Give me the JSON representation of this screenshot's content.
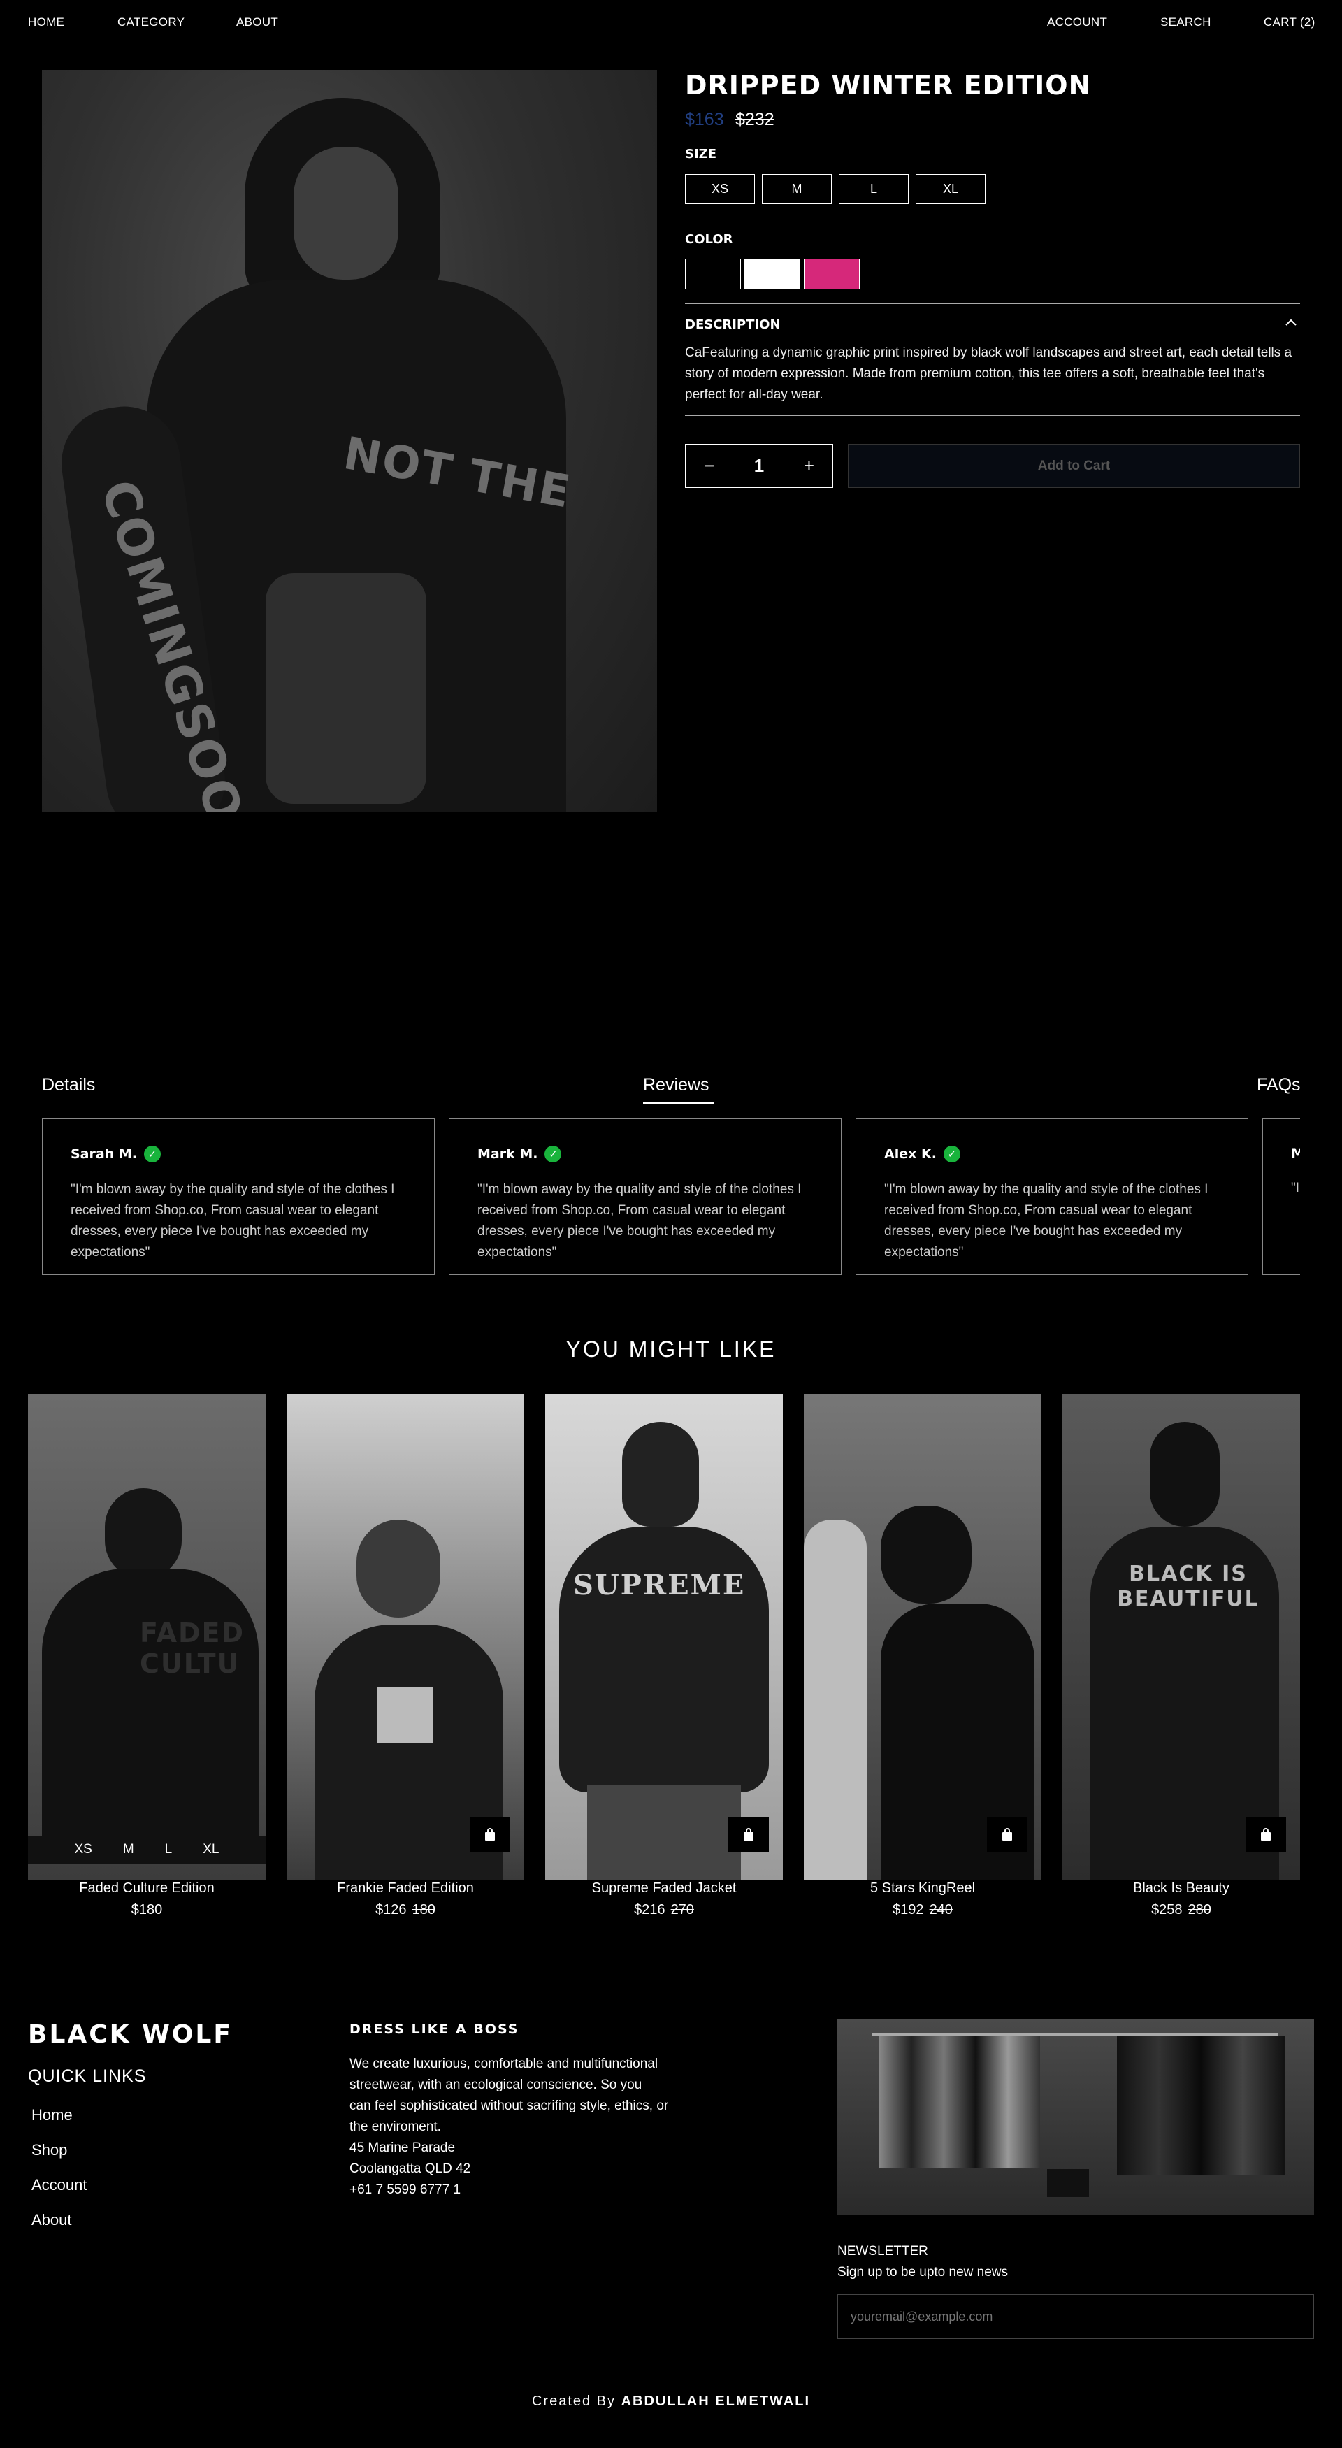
{
  "nav": {
    "home": "HOME",
    "category": "CATEGORY",
    "about": "ABOUT",
    "account": "ACCOUNT",
    "search": "SEARCH",
    "cart": "CART (2)"
  },
  "product": {
    "title": "DRIPPED WINTER EDITION",
    "price": "$163",
    "old_price": "$232",
    "size_label": "SIZE",
    "sizes": [
      "XS",
      "M",
      "L",
      "XL"
    ],
    "color_label": "COLOR",
    "colors": [
      "#000000",
      "#ffffff",
      "#d6287a"
    ],
    "description_label": "DESCRIPTION",
    "description": "CaFeaturing a dynamic graphic print inspired by black wolf landscapes and street art, each detail tells a story of modern expression. Made from premium cotton, this tee offers a soft, breathable feel that's perfect for all-day wear.",
    "quantity": "1",
    "add_to_cart": "Add to Cart",
    "image_text": {
      "a": "NOT THE",
      "b": "COMINGSOON"
    }
  },
  "tabs": {
    "details": "Details",
    "reviews": "Reviews",
    "faqs": "FAQs"
  },
  "reviews": [
    {
      "name": "Sarah M.",
      "text": "\"I'm blown away by the quality and style of the clothes I received from Shop.co, From casual wear to elegant dresses, every piece I've bought has exceeded my expectations\""
    },
    {
      "name": "Mark M.",
      "text": "\"I'm blown away by the quality and style of the clothes I received from Shop.co, From casual wear to elegant dresses, every piece I've bought has exceeded my expectations\""
    },
    {
      "name": "Alex K.",
      "text": "\"I'm blown away by the quality and style of the clothes I received from Shop.co, From casual wear to elegant dresses, every piece I've bought has exceeded my expectations\""
    },
    {
      "name": "M",
      "text": "\"I' c to e"
    }
  ],
  "you_might_like": {
    "title": "YOU MIGHT LIKE",
    "hover_sizes": [
      "XS",
      "M",
      "L",
      "XL"
    ],
    "items": [
      {
        "name": "Faded Culture Edition",
        "price": "$180",
        "old": "",
        "print": "FADED CULTU"
      },
      {
        "name": "Frankie Faded Edition",
        "price": "$126",
        "old": "180",
        "print": ""
      },
      {
        "name": "Supreme Faded Jacket",
        "price": "$216",
        "old": "270",
        "print": "SUPREME"
      },
      {
        "name": "5 Stars KingReel",
        "price": "$192",
        "old": "240",
        "print": ""
      },
      {
        "name": "Black Is Beauty",
        "price": "$258",
        "old": "280",
        "print": "BLACK IS BEAUTIFUL"
      }
    ]
  },
  "footer": {
    "brand": "BLACK WOLF",
    "quick_links_title": "QUICK LINKS",
    "links": [
      "Home",
      "Shop",
      "Account",
      "About"
    ],
    "tagline": "DRESS LIKE A BOSS",
    "about": [
      "We create luxurious, comfortable and multifunctional",
      "streetwear, with an ecological conscience. So you",
      "can feel sophisticated without sacrifing style, ethics, or",
      "the enviroment.",
      "45 Marine Parade",
      "Coolangatta QLD 42",
      "+61 7 5599 6777 1"
    ],
    "newsletter_title": "NEWSLETTER",
    "newsletter_sub": "Sign up to be upto new news",
    "email_placeholder": "youremail@example.com",
    "credit_prefix": "Created By",
    "credit_name": "ABDULLAH ELMETWALI"
  }
}
